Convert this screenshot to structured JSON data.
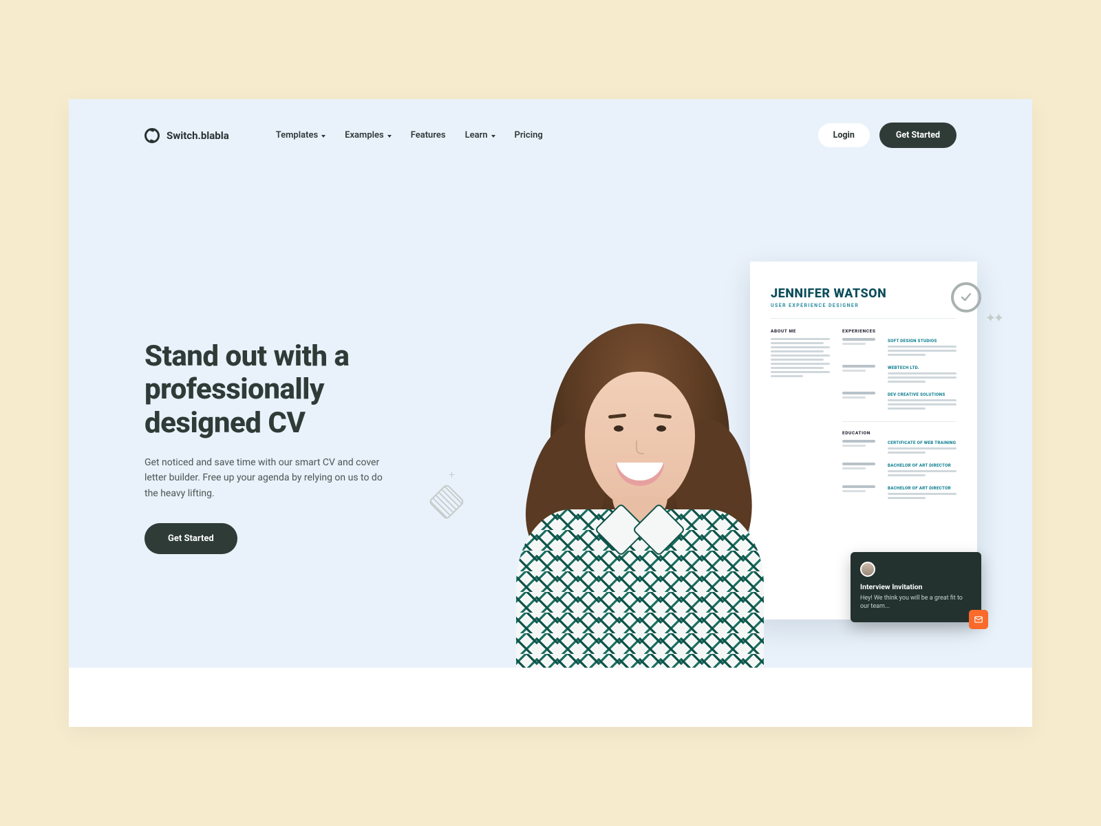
{
  "brand": "Switch.blabla",
  "nav": {
    "templates": "Templates",
    "examples": "Examples",
    "features": "Features",
    "learn": "Learn",
    "pricing": "Pricing",
    "login": "Login",
    "get_started": "Get Started"
  },
  "hero": {
    "title": "Stand out with a professionally designed CV",
    "subtitle": "Get noticed and save time with our smart CV and cover letter builder. Free up your agenda by relying on us to do the heavy lifting.",
    "cta": "Get Started"
  },
  "cv": {
    "name": "JENNIFER WATSON",
    "role": "USER EXPERIENCE DESIGNER",
    "about_label": "ABOUT ME",
    "exp_label": "EXPERIENCES",
    "edu_label": "EDUCATION",
    "exp": [
      "SOFT DESIGN STUDIOS",
      "WEBTECH LTD.",
      "DEV CREATIVE SOLUTIONS"
    ],
    "edu": [
      "CERTIFICATE OF WEB TRAINING",
      "BACHELOR OF ART DIRECTOR",
      "BACHELOR OF ART DIRECTOR"
    ]
  },
  "invite": {
    "title": "Interview Invitation",
    "body": "Hey! We think you will be a great fit to our team..."
  }
}
